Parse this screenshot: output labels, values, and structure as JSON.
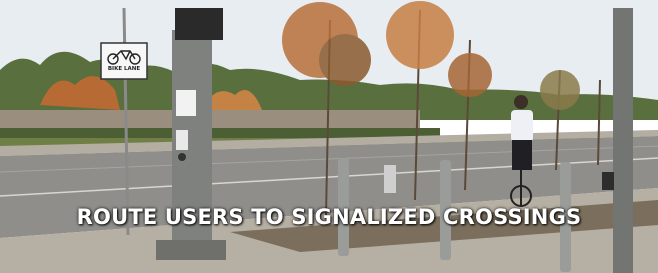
{
  "photo": {
    "caption": "ROUTE USERS TO SIGNALIZED CROSSINGS",
    "sign_text": "BIKE LANE",
    "colors": {
      "sky": "#e9eef3",
      "road": "#8d8c88",
      "sidewalk": "#b9b3a8",
      "foliage_orange": "#c9783a",
      "foliage_green": "#4f6b35",
      "pole": "#7d7f7d",
      "caption_text": "#ffffff"
    }
  }
}
